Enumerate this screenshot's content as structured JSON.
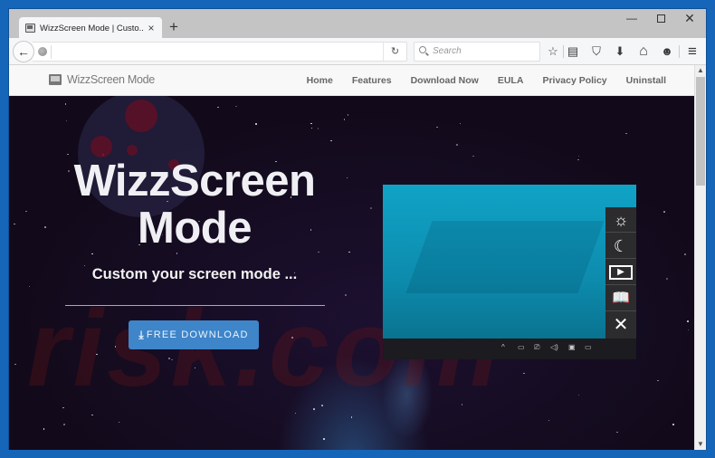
{
  "browser": {
    "tab": {
      "title": "WizzScreen Mode | Custo...",
      "close": "×"
    },
    "new_tab": "+",
    "window_controls": {
      "minimize": "—",
      "maximize": "□",
      "close": "✕"
    },
    "nav": {
      "back": "←",
      "url_value": "",
      "reload": "↻",
      "search_placeholder": "Search"
    },
    "toolbar_icons": [
      "star-icon",
      "reading-list-icon",
      "pocket-icon",
      "download-icon",
      "home-icon",
      "chat-icon",
      "menu-icon"
    ],
    "toolbar_glyphs": {
      "star": "☆",
      "reading_list": "▤",
      "pocket": "⛉",
      "download": "⬇",
      "home": "⌂",
      "chat": "☻",
      "menu": "≡"
    }
  },
  "site": {
    "brand": "WizzScreen Mode",
    "nav": [
      "Home",
      "Features",
      "Download Now",
      "EULA",
      "Privacy Policy",
      "Uninstall"
    ]
  },
  "hero": {
    "title_line1": "WizzScreen",
    "title_line2": "Mode",
    "subtitle": "Custom your screen mode ...",
    "download_button": "FREE DOWNLOAD",
    "download_icon": "⤓"
  },
  "preview": {
    "side_buttons": [
      {
        "name": "brightness",
        "glyph": "☼"
      },
      {
        "name": "night-mode",
        "glyph": "☾"
      },
      {
        "name": "video-mode",
        "glyph": "▶"
      },
      {
        "name": "reading-mode",
        "glyph": "📖"
      },
      {
        "name": "close",
        "glyph": "✕"
      }
    ],
    "tray_glyphs": [
      "^",
      "▭",
      "⎚",
      "◁)",
      "▣",
      "▭"
    ]
  },
  "watermark": "risk.com",
  "colors": {
    "window_frame": "#1565b8",
    "download_button": "#3e85c9",
    "preview_screen": "#10a3c6",
    "hero_bg": "#150a1d"
  }
}
